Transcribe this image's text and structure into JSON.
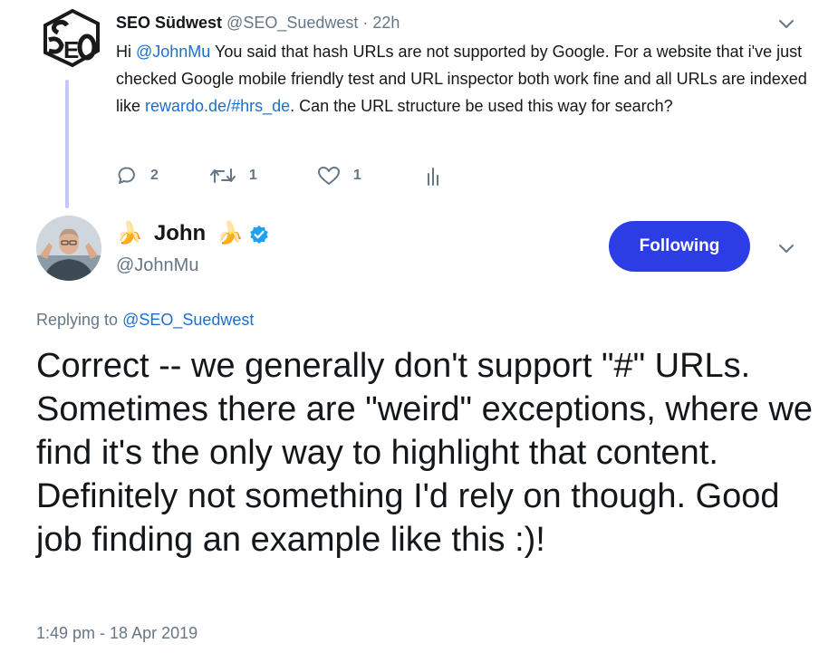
{
  "parent": {
    "avatar_icon": "seo-suedwest-logo",
    "name": "SEO Südwest",
    "handle": "@SEO_Suedwest",
    "separator": " · ",
    "time": "22h",
    "text_before_mention": "Hi ",
    "mention": "@JohnMu",
    "text_after_mention": " You said that hash URLs are not supported by Google. For a website that i've just checked Google mobile friendly test and URL inspector both work fine and all URLs are indexed like ",
    "link": "rewardo.de/#hrs_de",
    "text_after_link": ". Can the URL structure be used this way for search?",
    "actions": {
      "reply_icon": "reply-icon",
      "replies": "2",
      "retweet_icon": "retweet-icon",
      "retweets": "1",
      "like_icon": "heart-icon",
      "likes": "1",
      "analytics_icon": "analytics-icon"
    },
    "menu_icon": "chevron-down-icon"
  },
  "main": {
    "avatar_icon": "user-photo-avatar",
    "name_prefix_emoji": "🍌",
    "name": "John",
    "name_suffix_emoji": "🍌",
    "verified_icon": "verified-badge-icon",
    "handle": "@JohnMu",
    "follow_label": "Following",
    "menu_icon": "chevron-down-icon",
    "replying_prefix": "Replying to ",
    "replying_to": "@SEO_Suedwest",
    "text": "Correct -- we generally don't support \"#\" URLs. Sometimes there are \"weird\" exceptions, where we find it's the only way to highlight that content. Definitely not something I'd rely on though. Good job finding an example like this :)!",
    "timestamp": "1:49 pm - 18 Apr 2019"
  },
  "colors": {
    "accent": "#1b6fd1",
    "button": "#2d3de6",
    "muted": "#657786",
    "thread_line": "#c3c7ff"
  }
}
